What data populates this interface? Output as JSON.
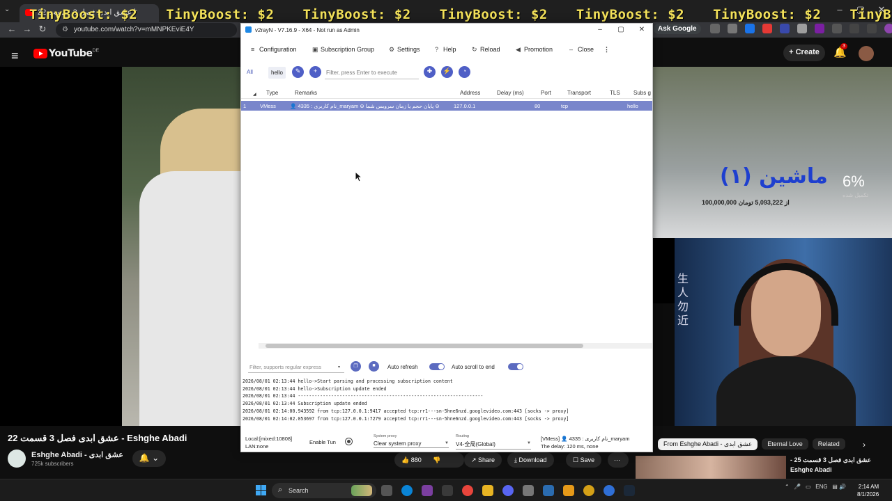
{
  "browser": {
    "tab_title": "عشق ابدی فصل 3 قسمت 22",
    "url": "youtube.com/watch?v=mMNPKEviE4Y",
    "ask_google": "Ask Google",
    "overlay_text": "TinyBoost: $2"
  },
  "youtube": {
    "logo_text": "YouTube",
    "logo_region": "DE",
    "create_label": "Create",
    "notifications_count": "3",
    "video_title": "عشق ابدی فصل 3 قسمت 22 - Eshghe Abadi",
    "channel_name": "Eshghe Abadi - عشق ابدی",
    "subscribers": "725k subscribers",
    "like_count": "880",
    "share_label": "Share",
    "download_label": "Download",
    "save_label": "Save",
    "chips": [
      "From Eshghe Abadi - عشق ابدی",
      "Eternal Love",
      "Related"
    ],
    "related_title": "عشق ابدی فصل 3 قسمت 25 -",
    "related_channel": "Eshghe Abadi",
    "video_overlay": {
      "banner_text": "ماشین (۱)",
      "percent": "6%",
      "percent_label": "تکمیل شده",
      "amount_text": "100,000,000 از 5,093,222 تومان"
    }
  },
  "v2rayn": {
    "title": "v2rayN - V7.16.9 - X64 - Not run as Admin",
    "menu": [
      {
        "icon": "≡",
        "label": "Configuration"
      },
      {
        "icon": "▣",
        "label": "Subscription Group"
      },
      {
        "icon": "⚙",
        "label": "Settings"
      },
      {
        "icon": "?",
        "label": "Help"
      },
      {
        "icon": "↻",
        "label": "Reload"
      },
      {
        "icon": "◀",
        "label": "Promotion"
      },
      {
        "icon": "–",
        "label": "Close"
      }
    ],
    "filter_tabs": {
      "all": "All",
      "group": "hello"
    },
    "filter_placeholder": "Filter, press Enter to execute",
    "columns": [
      "Type",
      "Remarks",
      "Address",
      "Delay (ms)",
      "Port",
      "Transport",
      "TLS",
      "Subs g"
    ],
    "rows": [
      {
        "num": "1",
        "type": "VMess",
        "remarks": "👤 4335 : نام کاربری_maryam ⊖ پایان حجم یا زمان سرویس شما ⊖",
        "address": "127.0.0.1",
        "delay": "",
        "port": "80",
        "transport": "tcp",
        "tls": "",
        "subs": "hello"
      }
    ],
    "log_filter_placeholder": "Filter, supports regular express",
    "auto_refresh": "Auto refresh",
    "auto_scroll": "Auto scroll to end",
    "log_lines": [
      "2026/08/01 02:13:44 hello->Start parsing and processing subscription content",
      "2026/08/01 02:13:44 hello->Subscription update ended",
      "2026/08/01 02:13:44 -------------------------------------------------------------------",
      "2026/08/01 02:13:44 Subscription update ended",
      "2026/08/01 02:14:00.943592 from tcp:127.0.0.1:9417 accepted tcp:rr1---sn-5hne6nzd.googlevideo.com:443 [socks -> proxy]",
      "2026/08/01 02:14:02.053697 from tcp:127.0.0.1:7279 accepted tcp:rr1---sn-5hne6nzd.googlevideo.com:443 [socks -> proxy]"
    ],
    "status": {
      "local": "Local:[mixed:10808]",
      "lan": "LAN:none",
      "enable_tun": "Enable Tun",
      "system_proxy_label": "System proxy",
      "system_proxy_value": "Clear system proxy",
      "routing_label": "Routing",
      "routing_value": "V4-全局(Global)",
      "server": "[VMess] 👤 4335 : نام کاربری_maryam",
      "delay": "The delay: 120 ms, none"
    }
  },
  "taskbar": {
    "search_label": "Search",
    "lang": "ENG",
    "time": "2:14 AM",
    "date": "8/1/2026"
  }
}
